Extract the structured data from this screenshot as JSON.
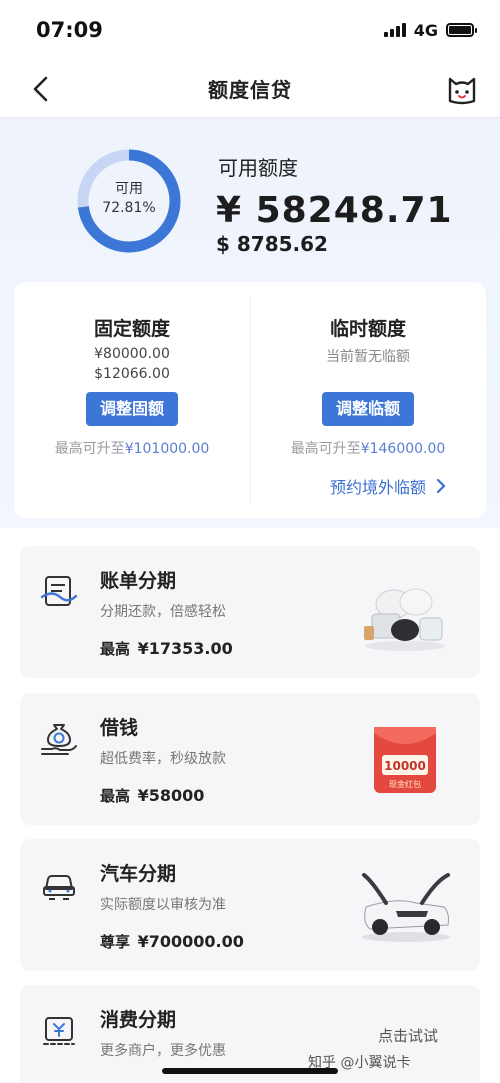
{
  "status_bar": {
    "time": "07:09",
    "network": "4G"
  },
  "nav": {
    "title": "额度信贷"
  },
  "hero": {
    "donut_label": "可用",
    "donut_percent": "72.81%",
    "donut_fraction": 0.7281,
    "available_title": "可用额度",
    "available_cny": "¥ 58248.71",
    "available_usd": "$ 8785.62"
  },
  "fixed": {
    "title": "固定额度",
    "cny": "¥80000.00",
    "usd": "$12066.00",
    "button": "调整固额",
    "max_prefix": "最高可升至",
    "max_value": "¥101000.00"
  },
  "temporary": {
    "title": "临时额度",
    "note": "当前暂无临额",
    "button": "调整临额",
    "max_prefix": "最高可升至",
    "max_value": "¥146000.00",
    "reserve_link": "预约境外临额"
  },
  "products": [
    {
      "title": "账单分期",
      "subtitle": "分期还款，倍感轻松",
      "amount_prefix": "最高",
      "amount": "¥17353.00"
    },
    {
      "title": "借钱",
      "subtitle": "超低费率，秒级放款",
      "amount_prefix": "最高",
      "amount": "¥58000",
      "envelope_amount": "10000",
      "envelope_label": "现金红包"
    },
    {
      "title": "汽车分期",
      "subtitle": "实际额度以审核为准",
      "amount_prefix": "尊享",
      "amount": "¥700000.00"
    },
    {
      "title": "消费分期",
      "subtitle": "更多商户，更多优惠",
      "action": "点击试试"
    }
  ],
  "watermark": "知乎 @小翼说卡",
  "colors": {
    "accent": "#3c77d8",
    "donut_track": "#c6d6f4",
    "link": "#3c6fd1"
  }
}
